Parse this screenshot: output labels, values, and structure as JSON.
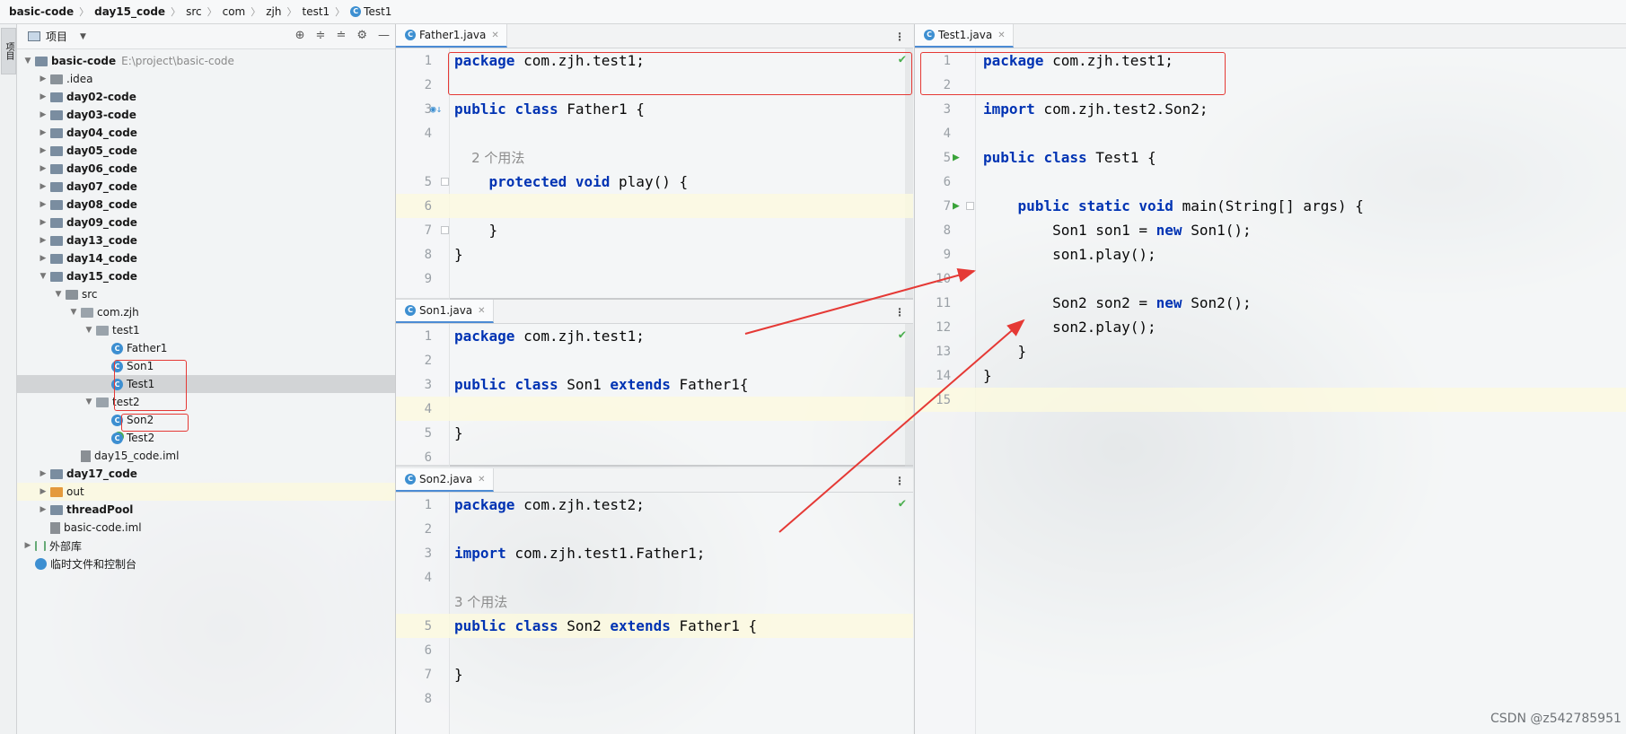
{
  "breadcrumb": [
    {
      "label": "basic-code",
      "bold": true
    },
    {
      "label": "day15_code",
      "bold": true
    },
    {
      "label": "src",
      "bold": false
    },
    {
      "label": "com",
      "bold": false
    },
    {
      "label": "zjh",
      "bold": false
    },
    {
      "label": "test1",
      "bold": false
    },
    {
      "label": "Test1",
      "bold": false,
      "icon": "class-icon"
    }
  ],
  "toolstrip": {
    "tab_label": "项目"
  },
  "project": {
    "title": "项目",
    "tools": [
      "locate-icon",
      "expand-all-icon",
      "collapse-all-icon",
      "gear-icon",
      "minimize-icon"
    ],
    "root": {
      "name": "basic-code",
      "path": "E:\\project\\basic-code"
    },
    "tree": [
      {
        "label": ".idea",
        "depth": 1,
        "arrow": "collapsed",
        "icon": "folder",
        "bold": false
      },
      {
        "label": "day02-code",
        "depth": 1,
        "arrow": "collapsed",
        "icon": "module",
        "bold": true
      },
      {
        "label": "day03-code",
        "depth": 1,
        "arrow": "collapsed",
        "icon": "module",
        "bold": true
      },
      {
        "label": "day04_code",
        "depth": 1,
        "arrow": "collapsed",
        "icon": "module",
        "bold": true
      },
      {
        "label": "day05_code",
        "depth": 1,
        "arrow": "collapsed",
        "icon": "module",
        "bold": true
      },
      {
        "label": "day06_code",
        "depth": 1,
        "arrow": "collapsed",
        "icon": "module",
        "bold": true
      },
      {
        "label": "day07_code",
        "depth": 1,
        "arrow": "collapsed",
        "icon": "module",
        "bold": true
      },
      {
        "label": "day08_code",
        "depth": 1,
        "arrow": "collapsed",
        "icon": "module",
        "bold": true
      },
      {
        "label": "day09_code",
        "depth": 1,
        "arrow": "collapsed",
        "icon": "module",
        "bold": true
      },
      {
        "label": "day13_code",
        "depth": 1,
        "arrow": "collapsed",
        "icon": "module",
        "bold": true
      },
      {
        "label": "day14_code",
        "depth": 1,
        "arrow": "collapsed",
        "icon": "module",
        "bold": true
      },
      {
        "label": "day15_code",
        "depth": 1,
        "arrow": "expanded",
        "icon": "module",
        "bold": true
      },
      {
        "label": "src",
        "depth": 2,
        "arrow": "expanded",
        "icon": "folder",
        "bold": false
      },
      {
        "label": "com.zjh",
        "depth": 3,
        "arrow": "expanded",
        "icon": "package",
        "bold": false
      },
      {
        "label": "test1",
        "depth": 4,
        "arrow": "expanded",
        "icon": "package",
        "bold": false
      },
      {
        "label": "Father1",
        "depth": 5,
        "arrow": "none",
        "icon": "class",
        "bold": false
      },
      {
        "label": "Son1",
        "depth": 5,
        "arrow": "none",
        "icon": "class",
        "bold": false
      },
      {
        "label": "Test1",
        "depth": 5,
        "arrow": "none",
        "icon": "class",
        "bold": false,
        "selected": true
      },
      {
        "label": "test2",
        "depth": 4,
        "arrow": "expanded",
        "icon": "package",
        "bold": false
      },
      {
        "label": "Son2",
        "depth": 5,
        "arrow": "none",
        "icon": "class",
        "bold": false
      },
      {
        "label": "Test2",
        "depth": 5,
        "arrow": "none",
        "icon": "class-run",
        "bold": false
      },
      {
        "label": "day15_code.iml",
        "depth": 3,
        "arrow": "none",
        "icon": "iml",
        "bold": false
      },
      {
        "label": "day17_code",
        "depth": 1,
        "arrow": "collapsed",
        "icon": "module",
        "bold": true
      },
      {
        "label": "out",
        "depth": 1,
        "arrow": "collapsed",
        "icon": "folder-orange",
        "bold": false,
        "highlight": true
      },
      {
        "label": "threadPool",
        "depth": 1,
        "arrow": "collapsed",
        "icon": "module",
        "bold": true
      },
      {
        "label": "basic-code.iml",
        "depth": 1,
        "arrow": "none",
        "icon": "iml",
        "bold": false
      },
      {
        "label": "外部库",
        "depth": 0,
        "arrow": "collapsed",
        "icon": "library",
        "bold": false
      },
      {
        "label": "临时文件和控制台",
        "depth": 0,
        "arrow": "none",
        "icon": "scratch",
        "bold": false
      }
    ]
  },
  "editors": {
    "father1": {
      "tab": "Father1.java",
      "lines": [
        {
          "n": "1",
          "tokens": [
            [
              "kw",
              "package"
            ],
            [
              "t",
              " com.zjh.test1;"
            ]
          ]
        },
        {
          "n": "2",
          "tokens": []
        },
        {
          "n": "3",
          "tokens": [
            [
              "kw",
              "public"
            ],
            [
              "t",
              " "
            ],
            [
              "kw",
              "class"
            ],
            [
              "t",
              " Father1 {"
            ]
          ],
          "gutter": "implemented"
        },
        {
          "n": "4",
          "tokens": []
        },
        {
          "n": "",
          "tokens": [
            [
              "hint",
              "    2 个用法"
            ]
          ]
        },
        {
          "n": "5",
          "tokens": [
            [
              "t",
              "    "
            ],
            [
              "kw",
              "protected"
            ],
            [
              "t",
              " "
            ],
            [
              "kw",
              "void"
            ],
            [
              "t",
              " play() {"
            ]
          ],
          "fold": true
        },
        {
          "n": "6",
          "tokens": [],
          "current": true
        },
        {
          "n": "7",
          "tokens": [
            [
              "t",
              "    }"
            ]
          ],
          "fold": true
        },
        {
          "n": "8",
          "tokens": [
            [
              "t",
              "}"
            ]
          ]
        },
        {
          "n": "9",
          "tokens": []
        }
      ]
    },
    "son1": {
      "tab": "Son1.java",
      "lines": [
        {
          "n": "1",
          "tokens": [
            [
              "kw",
              "package"
            ],
            [
              "t",
              " com.zjh.test1;"
            ]
          ]
        },
        {
          "n": "2",
          "tokens": []
        },
        {
          "n": "3",
          "tokens": [
            [
              "kw",
              "public"
            ],
            [
              "t",
              " "
            ],
            [
              "kw",
              "class"
            ],
            [
              "t",
              " Son1 "
            ],
            [
              "kw",
              "extends"
            ],
            [
              "t",
              " Father1{"
            ]
          ]
        },
        {
          "n": "4",
          "tokens": [],
          "current": true
        },
        {
          "n": "5",
          "tokens": [
            [
              "t",
              "}"
            ]
          ]
        },
        {
          "n": "6",
          "tokens": []
        }
      ]
    },
    "son2": {
      "tab": "Son2.java",
      "lines": [
        {
          "n": "1",
          "tokens": [
            [
              "kw",
              "package"
            ],
            [
              "t",
              " com.zjh.test2;"
            ]
          ]
        },
        {
          "n": "2",
          "tokens": []
        },
        {
          "n": "3",
          "tokens": [
            [
              "kw",
              "import"
            ],
            [
              "t",
              " com.zjh.test1.Father1;"
            ]
          ]
        },
        {
          "n": "4",
          "tokens": []
        },
        {
          "n": "",
          "tokens": [
            [
              "hint",
              "3 个用法"
            ]
          ]
        },
        {
          "n": "5",
          "tokens": [
            [
              "kw",
              "public"
            ],
            [
              "t",
              " "
            ],
            [
              "kw",
              "class"
            ],
            [
              "t",
              " Son2 "
            ],
            [
              "kw",
              "extends"
            ],
            [
              "t",
              " Father1 {"
            ]
          ],
          "current": true
        },
        {
          "n": "6",
          "tokens": []
        },
        {
          "n": "7",
          "tokens": [
            [
              "t",
              "}"
            ]
          ]
        },
        {
          "n": "8",
          "tokens": []
        }
      ]
    },
    "test1": {
      "tab": "Test1.java",
      "lines": [
        {
          "n": "1",
          "tokens": [
            [
              "kw",
              "package"
            ],
            [
              "t",
              " com.zjh.test1;"
            ]
          ]
        },
        {
          "n": "2",
          "tokens": []
        },
        {
          "n": "3",
          "tokens": [
            [
              "kw",
              "import"
            ],
            [
              "t",
              " com.zjh.test2.Son2;"
            ]
          ]
        },
        {
          "n": "4",
          "tokens": []
        },
        {
          "n": "5",
          "tokens": [
            [
              "kw",
              "public"
            ],
            [
              "t",
              " "
            ],
            [
              "kw",
              "class"
            ],
            [
              "t",
              " Test1 {"
            ]
          ],
          "gutter": "run"
        },
        {
          "n": "6",
          "tokens": []
        },
        {
          "n": "7",
          "tokens": [
            [
              "t",
              "    "
            ],
            [
              "kw",
              "public"
            ],
            [
              "t",
              " "
            ],
            [
              "kw",
              "static"
            ],
            [
              "t",
              " "
            ],
            [
              "kw",
              "void"
            ],
            [
              "t",
              " main(String[] args) {"
            ]
          ],
          "gutter": "run",
          "fold": true
        },
        {
          "n": "8",
          "tokens": [
            [
              "t",
              "        Son1 son1 = "
            ],
            [
              "kw",
              "new"
            ],
            [
              "t",
              " Son1();"
            ]
          ]
        },
        {
          "n": "9",
          "tokens": [
            [
              "t",
              "        son1.play();"
            ]
          ]
        },
        {
          "n": "10",
          "tokens": []
        },
        {
          "n": "11",
          "tokens": [
            [
              "t",
              "        Son2 son2 = "
            ],
            [
              "kw",
              "new"
            ],
            [
              "t",
              " Son2();"
            ]
          ]
        },
        {
          "n": "12",
          "tokens": [
            [
              "t",
              "        son2.play();"
            ]
          ]
        },
        {
          "n": "13",
          "tokens": [
            [
              "t",
              "    }"
            ]
          ]
        },
        {
          "n": "14",
          "tokens": [
            [
              "t",
              "}"
            ]
          ]
        },
        {
          "n": "15",
          "tokens": [],
          "current": true
        }
      ]
    }
  },
  "colors": {
    "keyword": "#0033b3",
    "annotation": "#e53935",
    "ok": "#4caf50"
  },
  "watermark": "CSDN @z542785951"
}
